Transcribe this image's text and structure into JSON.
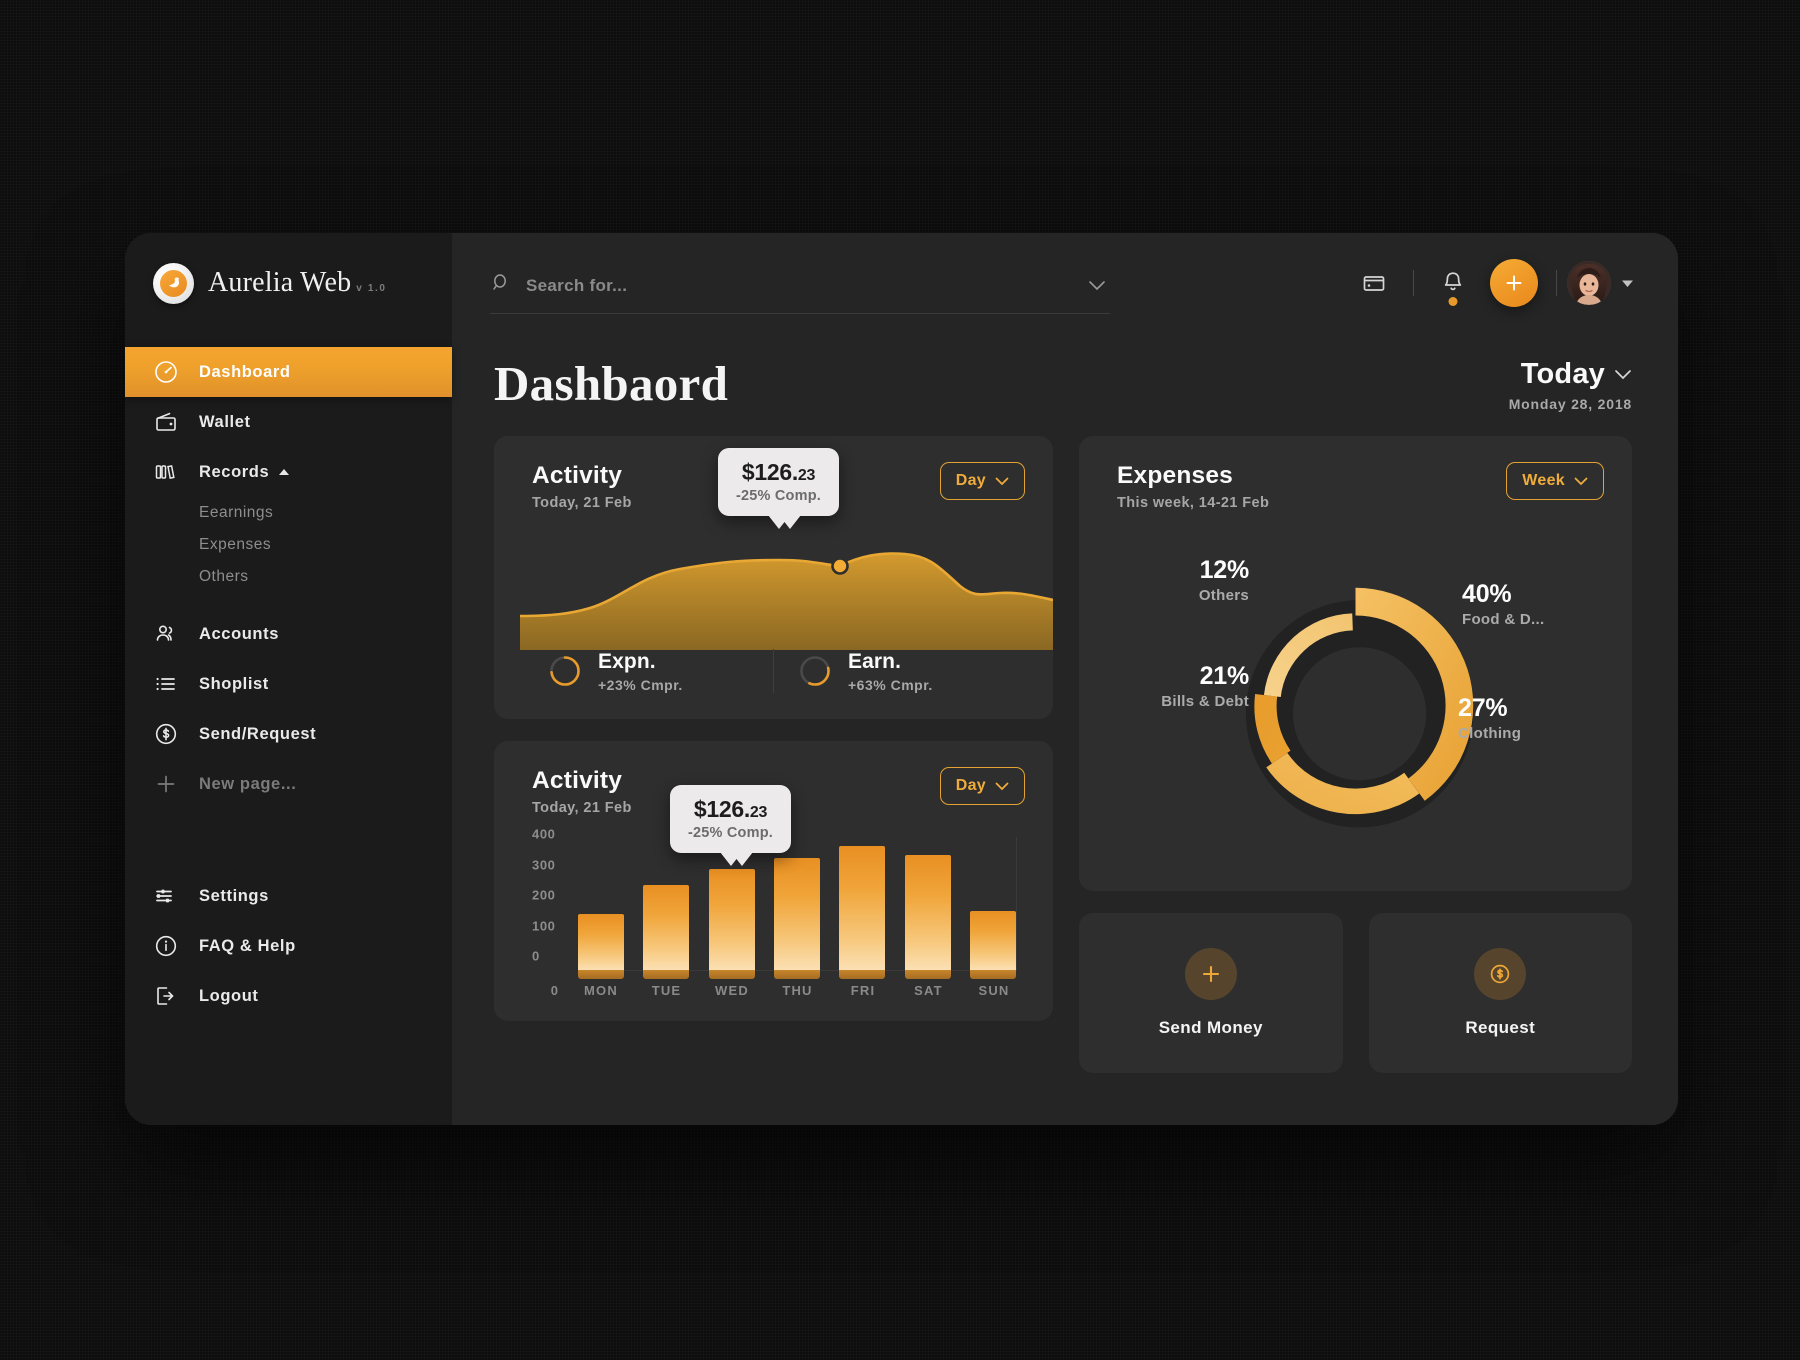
{
  "brand": {
    "name": "Aurelia Web",
    "version": "v 1.0",
    "logo_icon": "swan-logo-icon"
  },
  "search": {
    "placeholder": "Search for...",
    "value": "",
    "icon": "search-icon",
    "dropdown_icon": "chevron-down-icon"
  },
  "topbar": {
    "wallet_card_icon": "card-window-icon",
    "bell_icon": "bell-icon",
    "has_notification": true,
    "add_label": "+",
    "avatar_caret_icon": "caret-down-icon"
  },
  "sidebar": {
    "items": [
      {
        "label": "Dashboard",
        "icon": "speedometer-icon",
        "active": true
      },
      {
        "label": "Wallet",
        "icon": "wallet-icon",
        "active": false
      },
      {
        "label": "Records",
        "icon": "books-icon",
        "active": false,
        "expanded": true,
        "caret": "caret-up-icon"
      },
      {
        "label": "Accounts",
        "icon": "people-icon",
        "active": false
      },
      {
        "label": "Shoplist",
        "icon": "list-icon",
        "active": false
      },
      {
        "label": "Send/Request",
        "icon": "dollar-circle-icon",
        "active": false
      },
      {
        "label": "New page...",
        "icon": "plus-icon",
        "active": false,
        "muted": true
      }
    ],
    "records_sub": [
      "Eearnings",
      "Expenses",
      "Others"
    ],
    "bottom_items": [
      {
        "label": "Settings",
        "icon": "sliders-icon"
      },
      {
        "label": "FAQ & Help",
        "icon": "info-circle-icon"
      },
      {
        "label": "Logout",
        "icon": "logout-icon"
      }
    ]
  },
  "page": {
    "title": "Dashbaord",
    "date_label": "Today",
    "date_value": "Monday 28, 2018",
    "date_caret_icon": "chevron-down-icon"
  },
  "activity_area": {
    "title": "Activity",
    "subtitle": "Today, 21 Feb",
    "range_label": "Day",
    "range_caret_icon": "chevron-down-icon",
    "tooltip": {
      "amount": "$126.",
      "cents": "23",
      "compare": "-25% Comp."
    },
    "stats": [
      {
        "name": "Expn.",
        "compare": "+23% Cmpr.",
        "ring_icon": "ring-progress-icon"
      },
      {
        "name": "Earn.",
        "compare": "+63% Cmpr.",
        "ring_icon": "ring-progress-icon"
      }
    ]
  },
  "activity_bars": {
    "title": "Activity",
    "subtitle": "Today, 21 Feb",
    "range_label": "Day",
    "range_caret_icon": "chevron-down-icon",
    "tooltip": {
      "amount": "$126.",
      "cents": "23",
      "compare": "-25% Comp."
    }
  },
  "expenses": {
    "title": "Expenses",
    "subtitle": "This week, 14-21 Feb",
    "range_label": "Week",
    "range_caret_icon": "chevron-down-icon"
  },
  "actions": [
    {
      "label": "Send Money",
      "icon": "plus-icon"
    },
    {
      "label": "Request",
      "icon": "dollar-coin-icon"
    }
  ],
  "colors": {
    "accent": "#eda837",
    "accent_dark": "#e8881c",
    "card_bg": "#2e2e2e",
    "sidebar_bg": "#1b1b1b",
    "app_bg": "#252525"
  },
  "chart_data": [
    {
      "type": "bar",
      "title": "Activity",
      "subtitle": "Today, 21 Feb",
      "categories": [
        "MON",
        "TUE",
        "WED",
        "THU",
        "FRI",
        "SAT",
        "SUN"
      ],
      "values": [
        185,
        280,
        335,
        370,
        410,
        380,
        195
      ],
      "yticks": [
        0,
        100,
        200,
        300,
        400
      ],
      "ylim": [
        0,
        440
      ],
      "xlabel": "",
      "ylabel": "",
      "grid": false,
      "annotation": "$126.23 / -25% Comp. on WED"
    },
    {
      "type": "pie",
      "title": "Expenses",
      "subtitle": "This week, 14-21 Feb",
      "labels": [
        "Food & D...",
        "Clothing",
        "Bills & Debt",
        "Others"
      ],
      "values": [
        40,
        27,
        21,
        12
      ],
      "unit": "%",
      "legend": "around-donut"
    },
    {
      "type": "area",
      "title": "Activity",
      "subtitle": "Today, 21 Feb",
      "x": [
        0,
        1,
        2,
        3,
        4,
        5,
        6,
        7,
        8,
        9,
        10
      ],
      "values": [
        18,
        20,
        34,
        56,
        62,
        64,
        66,
        72,
        70,
        40,
        36
      ],
      "ylim": [
        0,
        100
      ],
      "grid": false,
      "annotation": "$126.23 / -25% Comp."
    }
  ]
}
